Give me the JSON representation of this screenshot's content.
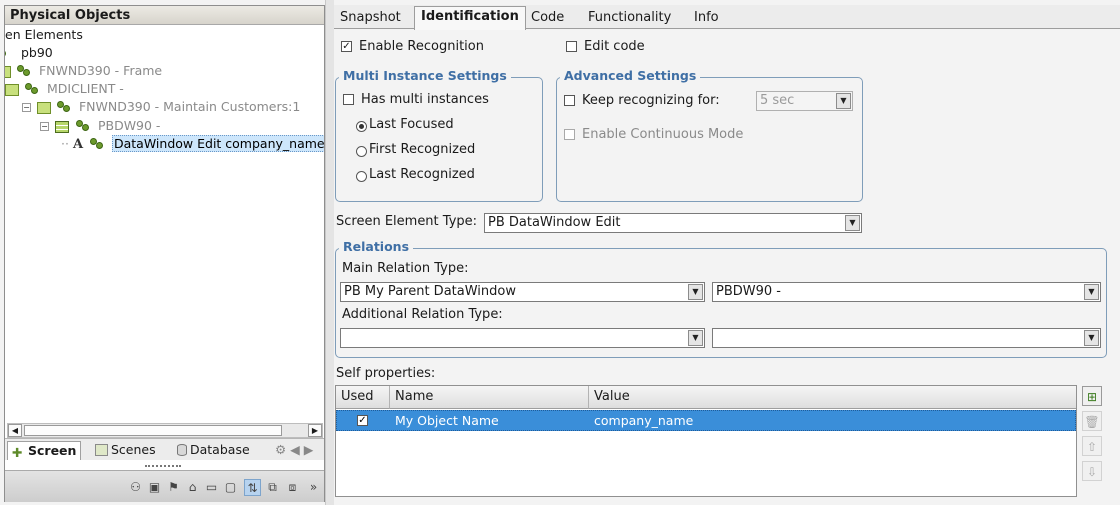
{
  "left_panel": {
    "title": "Physical Objects",
    "tree": [
      {
        "label": "en Elements",
        "dim": false
      },
      {
        "label": "pb90",
        "dim": false
      },
      {
        "label": "FNWND390 - Frame",
        "dim": true
      },
      {
        "label": "MDICLIENT -",
        "dim": true
      },
      {
        "label": "FNWND390 - Maintain Customers:1",
        "dim": true
      },
      {
        "label": "PBDW90 -",
        "dim": true
      },
      {
        "label": "DataWindow Edit company_name",
        "dim": false
      }
    ],
    "bottom_tabs": [
      {
        "label": "Screen",
        "icon": "screen-icon"
      },
      {
        "label": "Scenes",
        "icon": "scenes-icon"
      },
      {
        "label": "Database",
        "icon": "database-icon"
      }
    ]
  },
  "tabs": [
    "Snapshot",
    "Identification",
    "Code",
    "Functionality",
    "Info"
  ],
  "active_tab": "Identification",
  "identification": {
    "enable_recognition": {
      "label": "Enable Recognition",
      "checked": true
    },
    "edit_code": {
      "label": "Edit code",
      "checked": false
    },
    "multi_instance": {
      "title": "Multi Instance Settings",
      "has_multi": {
        "label": "Has multi instances",
        "checked": false
      },
      "options": [
        "Last Focused",
        "First Recognized",
        "Last Recognized"
      ],
      "selected": "Last Focused"
    },
    "advanced": {
      "title": "Advanced Settings",
      "keep_recognizing": {
        "label": "Keep recognizing for:",
        "checked": false
      },
      "keep_value": "5 sec",
      "continuous": {
        "label": "Enable Continuous Mode",
        "checked": false
      }
    },
    "screen_element_type": {
      "label": "Screen Element Type:",
      "value": "PB DataWindow Edit"
    },
    "relations": {
      "title": "Relations",
      "main_label": "Main Relation Type:",
      "main_value": "PB My Parent DataWindow",
      "main_target": "PBDW90 -",
      "additional_label": "Additional Relation Type:",
      "additional_value": "",
      "additional_target": ""
    },
    "self_properties": {
      "label": "Self properties:",
      "columns": [
        "Used",
        "Name",
        "Value"
      ],
      "rows": [
        {
          "used": true,
          "name": "My Object Name",
          "value": "company_name"
        }
      ]
    }
  },
  "colors": {
    "accent": "#3a8ed9",
    "legend": "#3f6fa5",
    "selected_tree": "#cde6fb"
  }
}
